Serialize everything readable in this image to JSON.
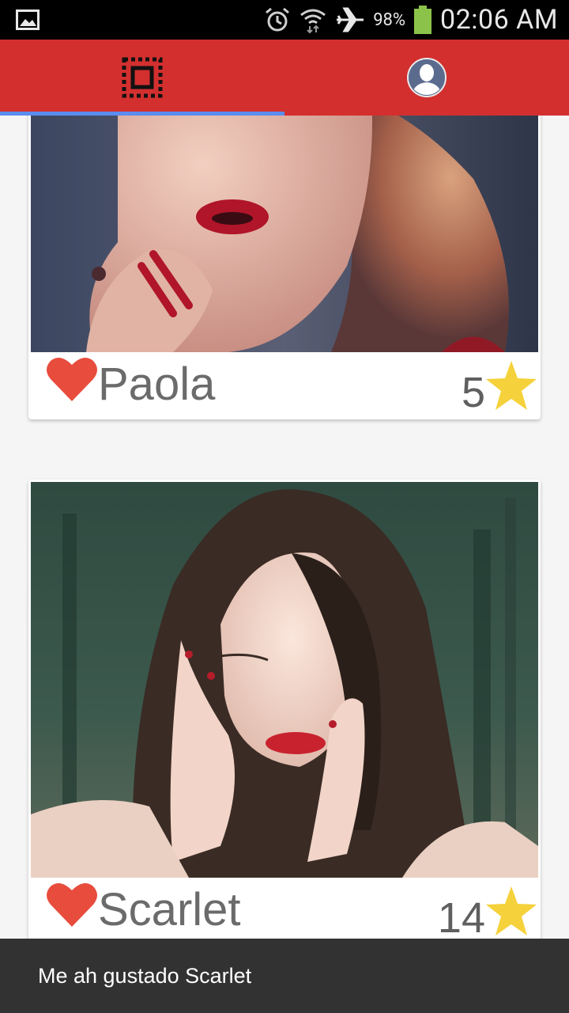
{
  "status_bar": {
    "battery": "98%",
    "time": "02:06 AM",
    "icons": [
      "gallery-icon",
      "alarm-icon",
      "wifi-icon",
      "airplane-icon",
      "battery-icon"
    ]
  },
  "tabs": [
    {
      "name": "feed",
      "icon": "cards-icon",
      "selected": true
    },
    {
      "name": "profile",
      "icon": "avatar-icon",
      "selected": false
    }
  ],
  "cards": [
    {
      "name": "Paola",
      "stars": "5",
      "liked": true
    },
    {
      "name": "Scarlet",
      "stars": "14",
      "liked": true
    }
  ],
  "toast": {
    "message": "Me ah gustado Scarlet"
  },
  "colors": {
    "app_bar": "#d32f2f",
    "tab_indicator": "#5b8def",
    "heart": "#e84c3d",
    "star": "#f5d13b",
    "toast_bg": "#323232"
  }
}
